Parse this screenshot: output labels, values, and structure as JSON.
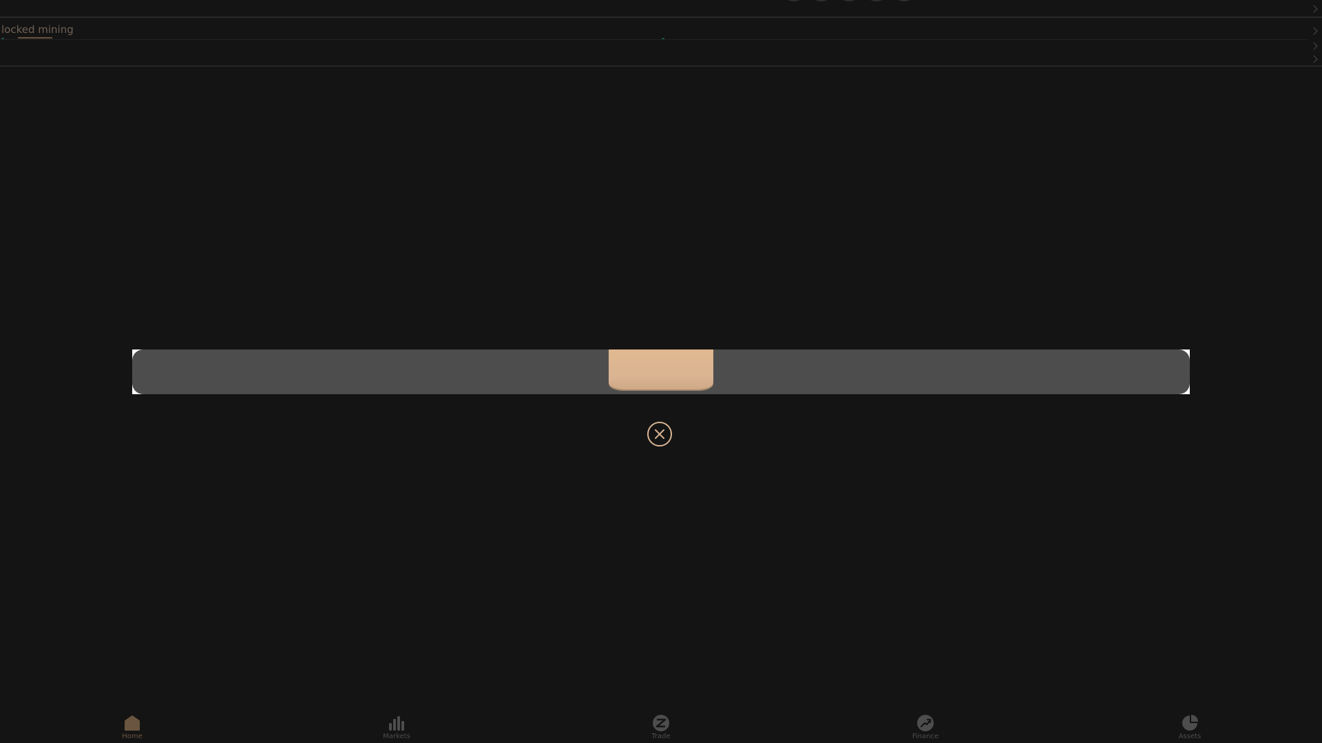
{
  "background": {
    "tab_label": "locked mining"
  },
  "modal": {
    "close_icon": "close-circle-icon"
  },
  "nav": {
    "items": [
      {
        "label": "Home",
        "icon": "home-icon",
        "active": true
      },
      {
        "label": "Markets",
        "icon": "bar-chart-icon",
        "active": false
      },
      {
        "label": "Trade",
        "icon": "trade-icon",
        "active": false
      },
      {
        "label": "Finance",
        "icon": "finance-icon",
        "active": false
      },
      {
        "label": "Assets",
        "icon": "pie-chart-icon",
        "active": false
      }
    ]
  },
  "colors": {
    "page_bg": "#141414",
    "accent": "#d9b494",
    "modal_bg": "#4d4d4d",
    "nav_inactive": "#4d4d4d",
    "nav_active": "#6a5540"
  }
}
